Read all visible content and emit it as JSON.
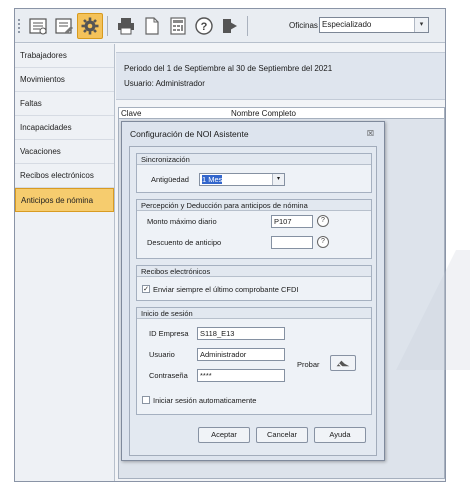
{
  "toolbar": {
    "buttons": [
      {
        "icon": "list-icon"
      },
      {
        "icon": "edit-list-icon"
      },
      {
        "icon": "gear-icon"
      },
      {
        "icon": "print-icon"
      },
      {
        "icon": "document-icon"
      },
      {
        "icon": "calculator-icon"
      },
      {
        "icon": "help-icon"
      },
      {
        "icon": "exit-icon"
      }
    ],
    "oficinas_label": "Oficinas",
    "oficinas_value": "Especializado"
  },
  "sidebar": {
    "items": [
      {
        "label": "Trabajadores"
      },
      {
        "label": "Movimientos"
      },
      {
        "label": "Faltas"
      },
      {
        "label": "Incapacidades"
      },
      {
        "label": "Vacaciones"
      },
      {
        "label": "Recibos electrónicos"
      },
      {
        "label": "Anticipos de nómina",
        "active": true
      }
    ]
  },
  "main": {
    "period_text": "Periodo del 1 de Septiembre al 30 de Septiembre del 2021",
    "user_text": "Usuario:   Administrador",
    "columns": [
      "Clave",
      "Nombre Completo"
    ]
  },
  "dialog": {
    "title": "Configuración de NOI Asistente",
    "close": "☒",
    "sync": {
      "title": "Sincronización",
      "antiguedad_label": "Antigüedad",
      "antiguedad_value": "1 Mes"
    },
    "percepcion": {
      "title": "Percepción y Deducción para anticipos de nómina",
      "monto_label": "Monto máximo diario",
      "monto_value": "P107",
      "descuento_label": "Descuento de anticipo",
      "descuento_value": ""
    },
    "recibos": {
      "title": "Recibos electrónicos",
      "enviar_label": "Enviar siempre el último comprobante CFDI",
      "enviar_checked": true
    },
    "sesion": {
      "title": "Inicio de sesión",
      "empresa_label": "ID Empresa",
      "empresa_value": "S118_E13",
      "usuario_label": "Usuario",
      "usuario_value": "Administrador",
      "password_label": "Contraseña",
      "password_value": "****",
      "probar_label": "Probar",
      "auto_label": "Iniciar sesión automaticamente",
      "auto_checked": false
    },
    "buttons": {
      "aceptar": "Aceptar",
      "cancelar": "Cancelar",
      "ayuda": "Ayuda"
    }
  }
}
